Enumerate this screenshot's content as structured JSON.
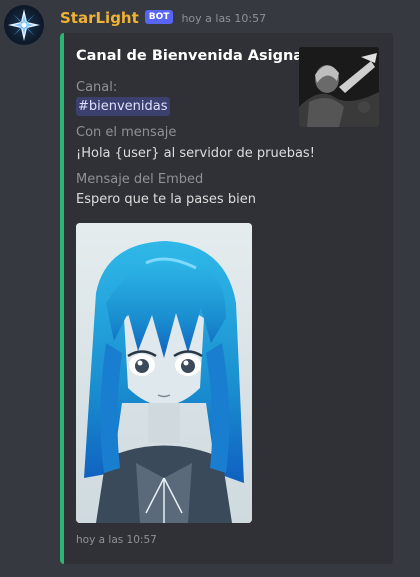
{
  "author": {
    "name": "StarLight",
    "badge": "BOT",
    "timestamp": "hoy a las 10:57",
    "avatar_icon": "star-logo-icon",
    "name_color": "#f0b232"
  },
  "embed": {
    "accent_color": "#2bb673",
    "title": "Canal de Bienvenida Asignado",
    "fields": [
      {
        "name": "Canal:",
        "value": "#bienvenidas"
      },
      {
        "name": "Con el mensaje",
        "value": "¡Hola {user} al servidor de pruebas!"
      },
      {
        "name": "Mensaje del Embed",
        "value": "Espero que te la pases bien"
      }
    ],
    "footer": "hoy a las 10:57"
  }
}
